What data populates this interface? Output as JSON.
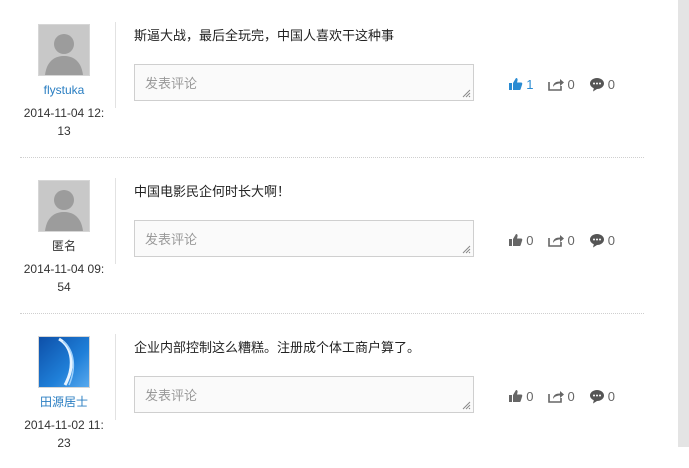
{
  "comments": [
    {
      "user": "flystuka",
      "user_is_link": true,
      "avatar": "default-avatar-icon",
      "time": "2014-11-04 12:13",
      "text": "斯逼大战，最后全玩完，中国人喜欢干这种事",
      "input_placeholder": "发表评论",
      "likes": "1",
      "shares": "0",
      "replies": "0",
      "liked": true
    },
    {
      "user": "匿名",
      "user_is_link": false,
      "avatar": "default-avatar-icon",
      "time": "2014-11-04 09:54",
      "text": "中国电影民企何时长大啊！",
      "input_placeholder": "发表评论",
      "likes": "0",
      "shares": "0",
      "replies": "0",
      "liked": false
    },
    {
      "user": "田源居士",
      "user_is_link": true,
      "avatar": "custom-blue-avatar",
      "time": "2014-11-02 11:23",
      "text": "企业内部控制这么糟糕。注册成个体工商户算了。",
      "input_placeholder": "发表评论",
      "likes": "0",
      "shares": "0",
      "replies": "0",
      "liked": false
    }
  ],
  "colors": {
    "link": "#2a7ec2",
    "liked": "#2a8bd2",
    "icon": "#666666",
    "divider": "#cfcfcf"
  }
}
